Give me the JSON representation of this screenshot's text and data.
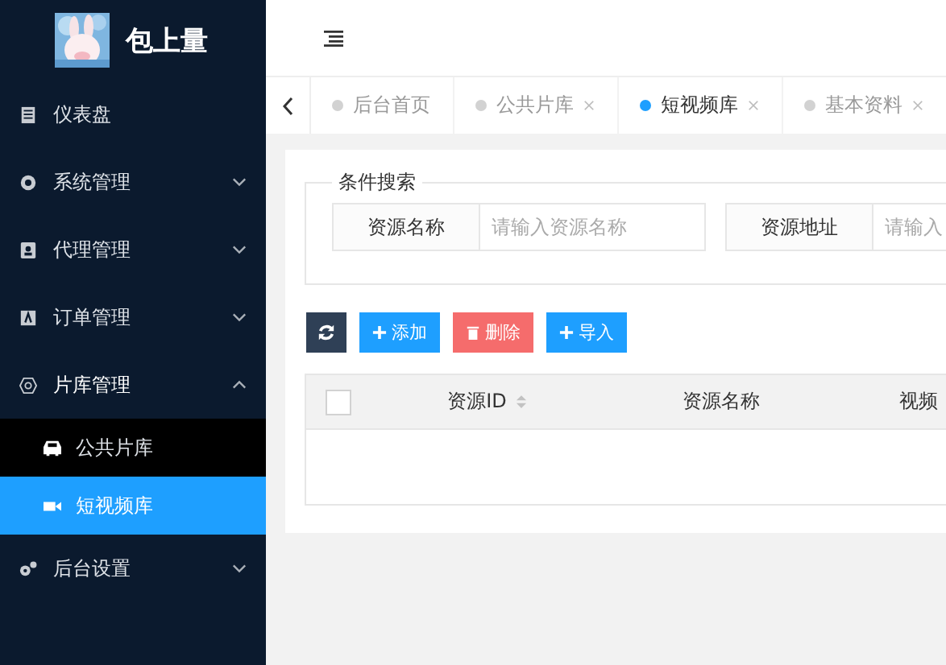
{
  "sidebar": {
    "title": "包上量",
    "items": [
      {
        "label": "仪表盘"
      },
      {
        "label": "系统管理",
        "expanded": false
      },
      {
        "label": "代理管理",
        "expanded": false
      },
      {
        "label": "订单管理",
        "expanded": false
      },
      {
        "label": "片库管理",
        "expanded": true,
        "children": [
          {
            "label": "公共片库",
            "selected": false
          },
          {
            "label": "短视频库",
            "selected": true
          }
        ]
      },
      {
        "label": "后台设置",
        "expanded": false
      }
    ]
  },
  "tabs": [
    {
      "label": "后台首页",
      "closable": false,
      "selected": false
    },
    {
      "label": "公共片库",
      "closable": true,
      "selected": false
    },
    {
      "label": "短视频库",
      "closable": true,
      "selected": true
    },
    {
      "label": "基本资料",
      "closable": true,
      "selected": false
    }
  ],
  "search": {
    "legend": "条件搜索",
    "fields": [
      {
        "label": "资源名称",
        "placeholder": "请输入资源名称"
      },
      {
        "label": "资源地址",
        "placeholder": "请输入"
      }
    ]
  },
  "toolbar": [
    {
      "kind": "refresh"
    },
    {
      "kind": "add",
      "label": "添加"
    },
    {
      "kind": "delete",
      "label": "删除"
    },
    {
      "kind": "import",
      "label": "导入"
    }
  ],
  "table": {
    "columns": [
      {
        "label": "资源ID",
        "sortable": true
      },
      {
        "label": "资源名称",
        "sortable": false
      },
      {
        "label": "视频",
        "sortable": false
      }
    ],
    "all_checked": false
  }
}
